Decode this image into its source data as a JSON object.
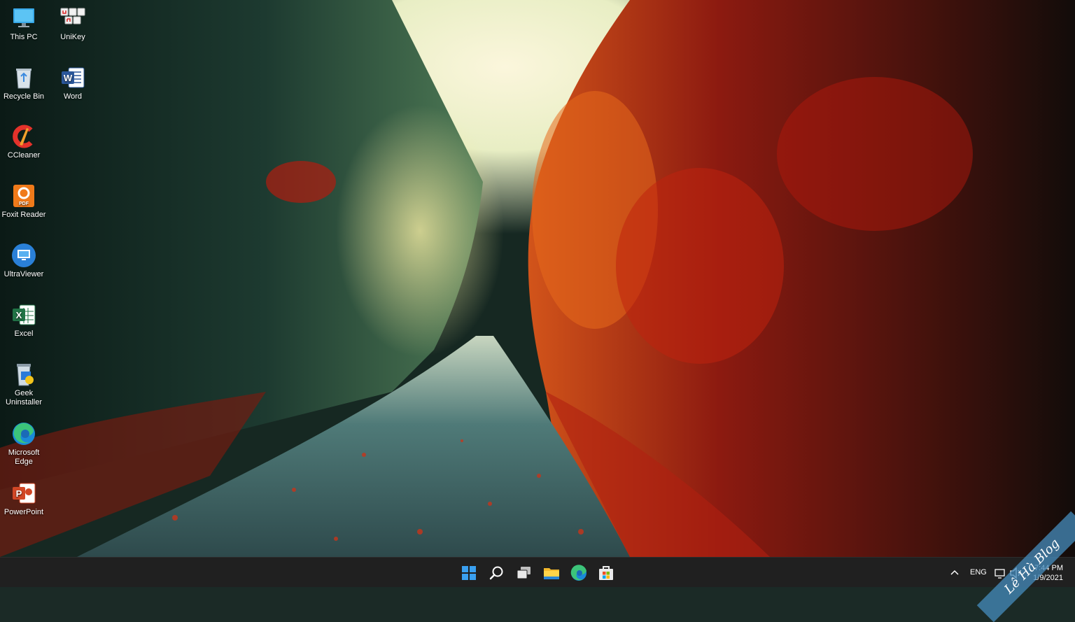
{
  "desktop": {
    "icons": [
      {
        "label": "This PC",
        "icon": "this-pc-icon"
      },
      {
        "label": "UniKey",
        "icon": "unikey-icon"
      },
      {
        "label": "Recycle Bin",
        "icon": "recycle-bin-icon"
      },
      {
        "label": "Word",
        "icon": "word-icon"
      },
      {
        "label": "CCleaner",
        "icon": "ccleaner-icon"
      },
      {
        "label": "Foxit Reader",
        "icon": "foxit-reader-icon"
      },
      {
        "label": "UltraViewer",
        "icon": "ultraviewer-icon"
      },
      {
        "label": "Excel",
        "icon": "excel-icon"
      },
      {
        "label": "Geek Uninstaller",
        "icon": "geek-uninstaller-icon"
      },
      {
        "label": "Microsoft Edge",
        "icon": "edge-icon"
      },
      {
        "label": "PowerPoint",
        "icon": "powerpoint-icon"
      }
    ]
  },
  "taskbar": {
    "pinned": [
      "start-icon",
      "search-icon",
      "task-view-icon",
      "file-explorer-icon",
      "edge-icon",
      "store-icon"
    ],
    "tray": {
      "language": "ENG",
      "time": "7:44 PM",
      "date": "1/9/2021"
    }
  },
  "watermark": "Lê Hà Blog",
  "colors": {
    "taskbar": "#202020",
    "accent": "#0078d4"
  }
}
